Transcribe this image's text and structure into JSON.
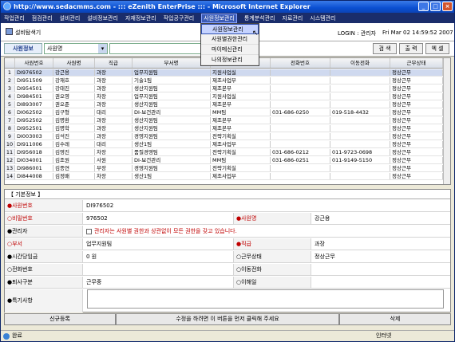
{
  "window": {
    "title": "http://www.sedacmms.com - ::: eZenith EnterPrise ::: - Microsoft Internet Explorer"
  },
  "menu": [
    "작업관리",
    "점검관리",
    "설비관리",
    "설비정보관리",
    "자재정보관리",
    "작업공구관리",
    "사원정보관리",
    "통계분석관리",
    "자료관리",
    "시스템관리"
  ],
  "dropdown": [
    "사원정보관리",
    "사원별권한관리",
    "마이메신관리",
    "나의정보관리"
  ],
  "header": {
    "page_title": "설비탐색기",
    "login": "LOGIN : 관리자",
    "time": "Fri Mar 02 14:59:52 2007"
  },
  "search": {
    "label": "사원정보",
    "select_value": "사원명",
    "buttons": [
      "검 색",
      "출 력",
      "엑 셀"
    ]
  },
  "grid": {
    "columns": [
      "",
      "사원번호",
      "사원명",
      "직급",
      "부서명",
      "",
      "전화번호",
      "이동전화",
      "근무상태"
    ],
    "rows": [
      [
        "1",
        "DI976502",
        "강근용",
        "과장",
        "업무지원팀",
        "지원사업실",
        "",
        "",
        "정상근무"
      ],
      [
        "2",
        "DI951509",
        "강재호",
        "과장",
        "기술1팀",
        "제조사업부",
        "",
        "",
        "정상근무"
      ],
      [
        "3",
        "DI954501",
        "강태진",
        "과장",
        "생산지원팀",
        "제조본부",
        "",
        "",
        "정상근무"
      ],
      [
        "4",
        "DI984501",
        "권오영",
        "차장",
        "업무지원팀",
        "지원사업실",
        "",
        "",
        "정상근무"
      ],
      [
        "5",
        "DI893007",
        "권오준",
        "과장",
        "생산지원팀",
        "제조본부",
        "",
        "",
        "정상근무"
      ],
      [
        "6",
        "DI062502",
        "김구형",
        "대리",
        "DI-보건관리",
        "MM팀",
        "031-686-0250",
        "019-518-4432",
        "정상근무"
      ],
      [
        "7",
        "DI952502",
        "김명환",
        "과장",
        "생산지원팀",
        "제조본부",
        "",
        "",
        "정상근무"
      ],
      [
        "8",
        "DI952501",
        "김명학",
        "과장",
        "생산지원팀",
        "제조본부",
        "",
        "",
        "정상근무"
      ],
      [
        "9",
        "DI003003",
        "김석진",
        "과장",
        "경영지원팀",
        "전략기획실",
        "",
        "",
        "정상근무"
      ],
      [
        "10",
        "DI911006",
        "김수레",
        "대리",
        "생산1팀",
        "제조사업부",
        "",
        "",
        "정상근무"
      ],
      [
        "11",
        "DI956018",
        "김영진",
        "차장",
        "품질경영팀",
        "전략기획실",
        "031-686-0212",
        "011-9723-0698",
        "정상근무"
      ],
      [
        "12",
        "DI034001",
        "김조원",
        "사원",
        "DI-보건관리",
        "MM팀",
        "031-686-0251",
        "011-9149-5150",
        "정상근무"
      ],
      [
        "13",
        "DI986001",
        "김종연",
        "부장",
        "경영지원팀",
        "전략기획실",
        "",
        "",
        "정상근무"
      ],
      [
        "14",
        "DI844008",
        "김정배",
        "차장",
        "생산1팀",
        "제조사업부",
        "",
        "",
        "정상근무"
      ]
    ]
  },
  "form": {
    "title": "【 기본정보 】",
    "emp_no_label": "사원번호",
    "emp_no": "DI976502",
    "pw_label": "비밀번호",
    "pw": "976502",
    "name_label": "사원명",
    "name": "강근용",
    "admin_label": "관리자",
    "admin_note": "관리자는 사원별 권한과 상관없이 모든 권한을 갖고 있습니다.",
    "dept_label": "부서",
    "dept": "업무지원팀",
    "rank_label": "직급",
    "rank": "과장",
    "hourly_label": "시간당임금",
    "hourly": "0 원",
    "status_label": "근무상태",
    "status": "정상근무",
    "phone_label": "전화번호",
    "mobile_label": "이동전화",
    "leave_label": "퇴사구분",
    "leave": "근무중",
    "leave_date_label": "이해일",
    "remarks_label": "특기사항"
  },
  "buttons": {
    "new": "신규등록",
    "hint": "수정을 하려면 이 버튼을 먼저 클릭해 주세요",
    "delete": "삭제"
  },
  "statusbar": {
    "left": "완료",
    "right": "인터넷"
  }
}
